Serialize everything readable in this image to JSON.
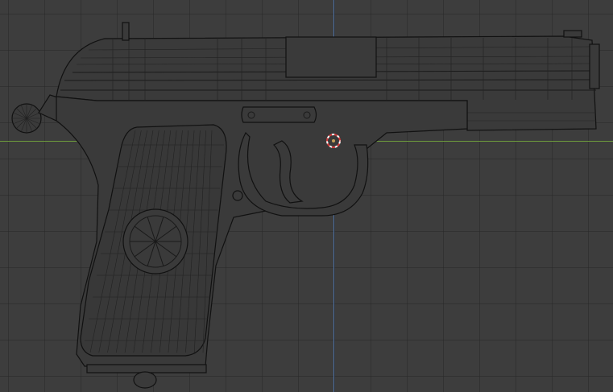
{
  "viewport": {
    "mode": "wireframe-edit",
    "background": "#3d3d3d",
    "grid_color": "#2b2b2b",
    "axis_x_color": "#6e9a3c",
    "axis_y_color": "#4f73a6"
  },
  "object": {
    "description_icon": "pistol-mesh"
  },
  "cursor": {
    "icon": "3d-cursor-icon",
    "color_a": "#d33a3a",
    "color_b": "#ffffff"
  }
}
